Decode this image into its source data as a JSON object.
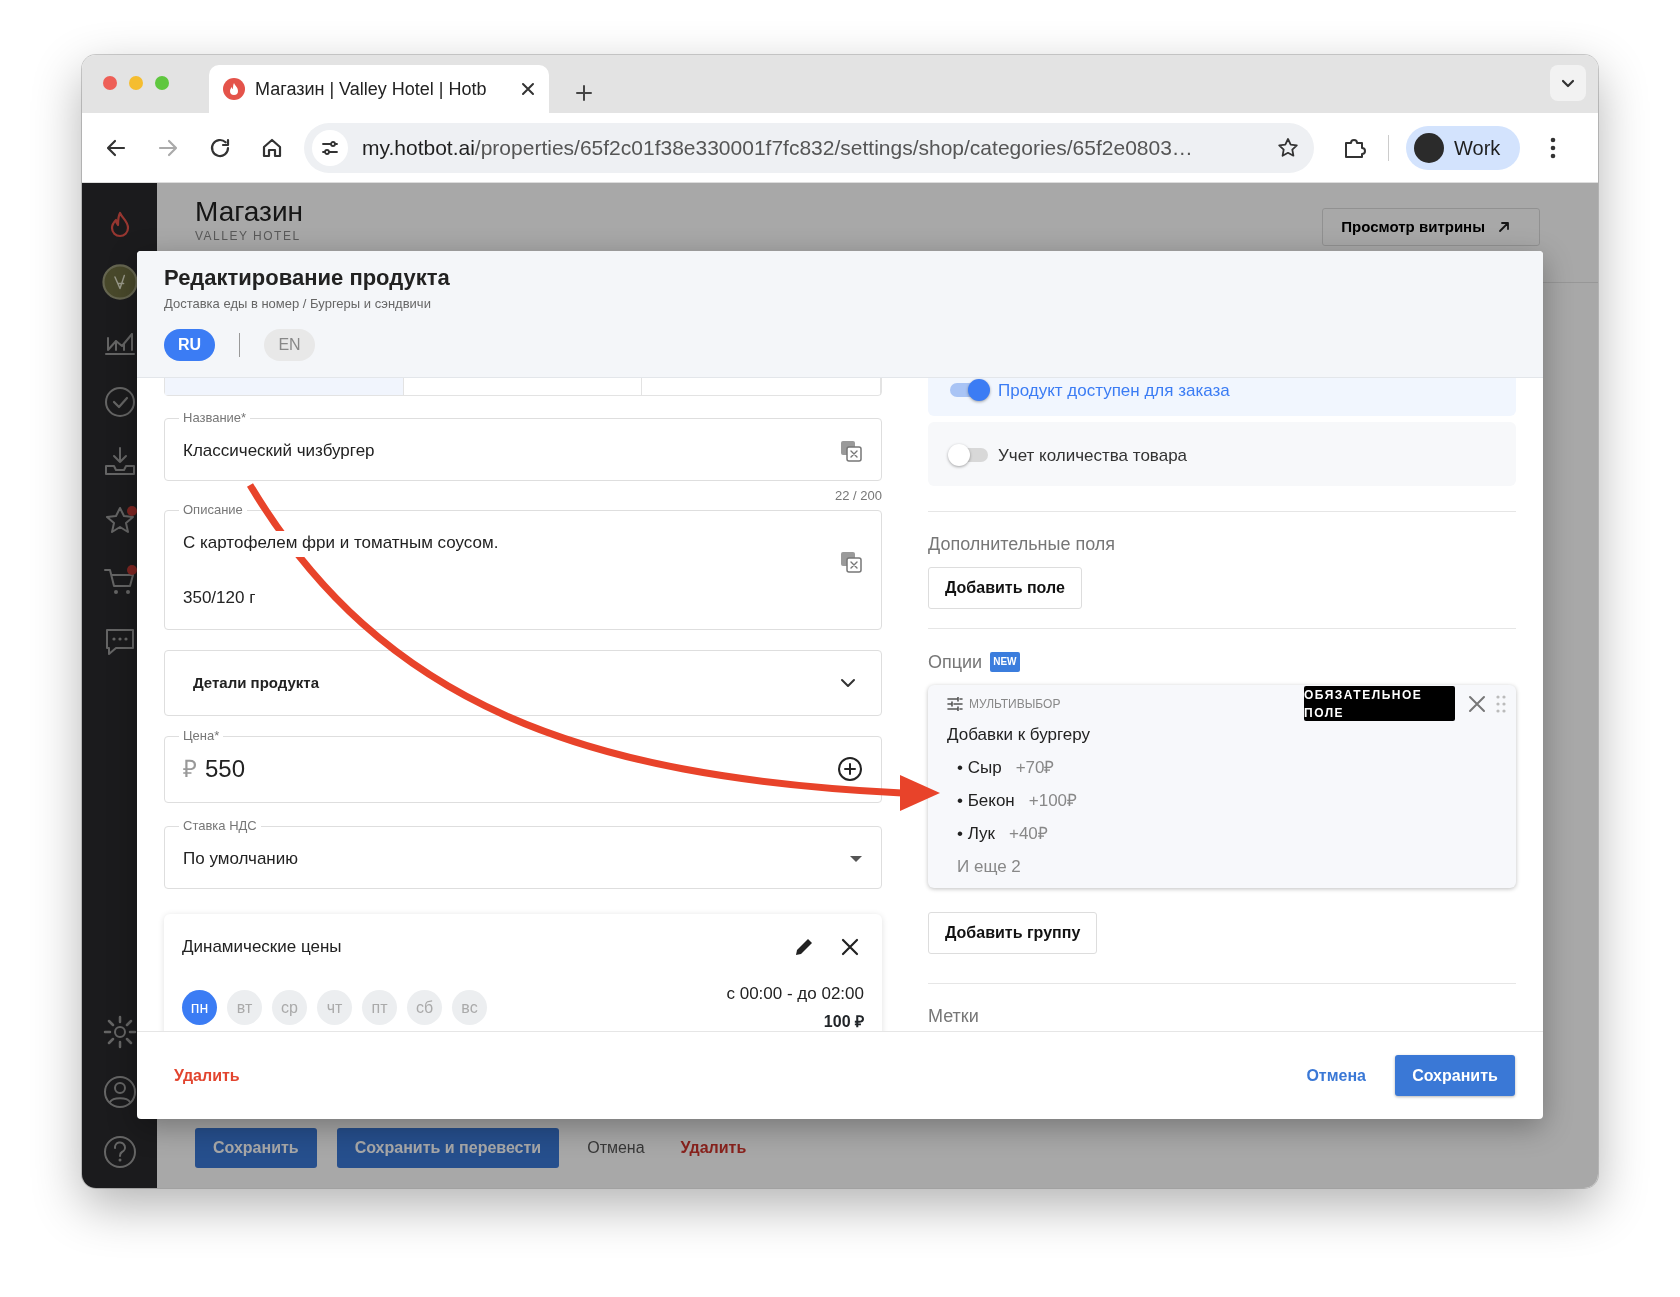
{
  "browser": {
    "tab_title": "Магазин | Valley Hotel | Hotb",
    "url_host": "my.hotbot.ai",
    "url_path": "/properties/65f2c01f38e330001f7fc832/settings/shop/categories/65f2e0803…",
    "profile": "Work"
  },
  "page": {
    "title": "Магазин",
    "subtitle": "VALLEY HOTEL",
    "storefront_button": "Просмотр витрины",
    "actions": [
      {
        "label": "Сохранить",
        "kind": "primary"
      },
      {
        "label": "Сохранить и перевести",
        "kind": "primary"
      },
      {
        "label": "Отмена",
        "kind": "plain"
      },
      {
        "label": "Удалить",
        "kind": "danger"
      }
    ]
  },
  "modal": {
    "title": "Редактирование продукта",
    "breadcrumb": "Доставка еды в номер / Бургеры и сэндвичи",
    "languages": [
      {
        "label": "RU",
        "selected": true
      },
      {
        "label": "EN",
        "selected": false
      }
    ],
    "left": {
      "name_field": {
        "label": "Название*",
        "value": "Классический чизбургер",
        "counter": "22 / 200"
      },
      "description_field": {
        "label": "Описание",
        "lines": [
          "С картофелем фри и томатным соусом.",
          "350/120 г"
        ]
      },
      "details": {
        "label": "Детали продукта",
        "expanded": false
      },
      "price_field": {
        "label": "Цена*",
        "currency": "₽",
        "value": "550"
      },
      "vat_field": {
        "label": "Ставка НДС",
        "value": "По умолчанию"
      },
      "dynamic_prices": {
        "title": "Динамические цены",
        "days": [
          {
            "label": "пн",
            "selected": true
          },
          {
            "label": "вт",
            "selected": false
          },
          {
            "label": "ср",
            "selected": false
          },
          {
            "label": "чт",
            "selected": false
          },
          {
            "label": "пт",
            "selected": false
          },
          {
            "label": "сб",
            "selected": false
          },
          {
            "label": "вс",
            "selected": false
          }
        ],
        "time": "с 00:00 - до 02:00",
        "price": "100 ₽"
      }
    },
    "right": {
      "availability": {
        "label": "Продукт доступен для заказа",
        "on": true
      },
      "stock_tracking": {
        "label": "Учет количества товара",
        "on": false
      },
      "extra_fields": {
        "title": "Дополнительные поля",
        "button": "Добавить поле"
      },
      "options": {
        "title": "Опции",
        "badge": "NEW",
        "group": {
          "type": "МУЛЬТИВЫБОР",
          "required_badge": "ОБЯЗАТЕЛЬНОЕ ПОЛЕ",
          "name": "Добавки к бургеру",
          "items": [
            {
              "name": "• Сыр",
              "price": "+70₽"
            },
            {
              "name": "• Бекон",
              "price": "+100₽"
            },
            {
              "name": "• Лук",
              "price": "+40₽"
            }
          ],
          "more": "И еще 2"
        },
        "add_group_button": "Добавить группу"
      },
      "tags": {
        "title": "Метки"
      }
    },
    "footer": {
      "delete": "Удалить",
      "cancel": "Отмена",
      "save": "Сохранить"
    }
  }
}
